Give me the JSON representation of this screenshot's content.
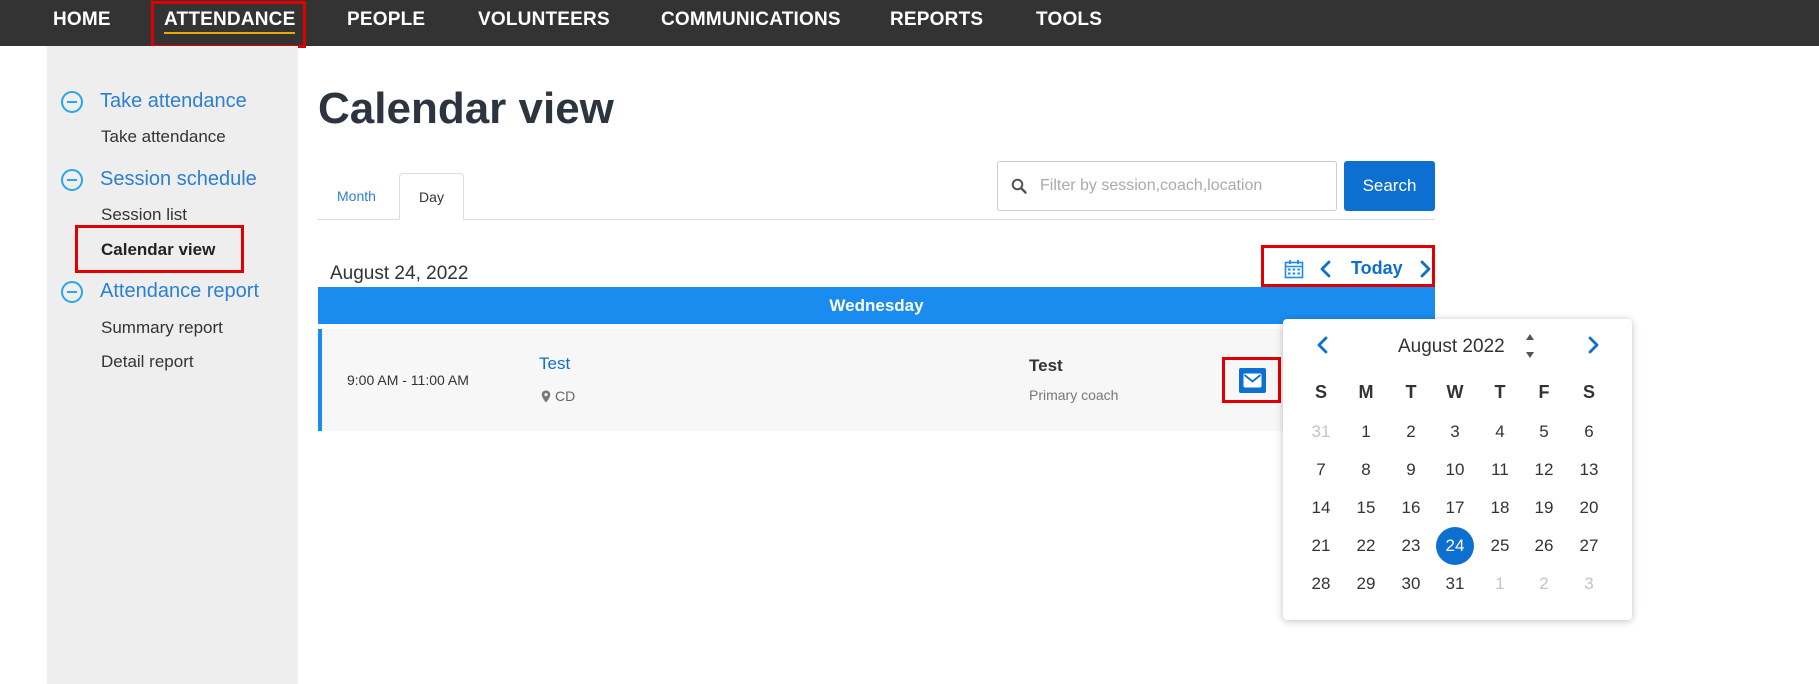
{
  "nav": {
    "items": [
      {
        "label": "HOME"
      },
      {
        "label": "ATTENDANCE"
      },
      {
        "label": "PEOPLE"
      },
      {
        "label": "VOLUNTEERS"
      },
      {
        "label": "COMMUNICATIONS"
      },
      {
        "label": "REPORTS"
      },
      {
        "label": "TOOLS"
      }
    ],
    "active": "ATTENDANCE"
  },
  "sidebar": {
    "groups": [
      {
        "label": "Take attendance",
        "links": [
          "Take attendance"
        ]
      },
      {
        "label": "Session schedule",
        "links": [
          "Session list",
          "Calendar view"
        ]
      },
      {
        "label": "Attendance report",
        "links": [
          "Summary report",
          "Detail report"
        ]
      }
    ],
    "current": "Calendar view"
  },
  "page": {
    "title": "Calendar view"
  },
  "tabs": {
    "month": "Month",
    "day": "Day",
    "active": "Day"
  },
  "search": {
    "placeholder": "Filter by session,coach,location",
    "value": "",
    "button": "Search"
  },
  "day_view": {
    "date": "August 24, 2022",
    "today_label": "Today",
    "weekday": "Wednesday",
    "sessions": [
      {
        "time": "9:00 AM - 11:00 AM",
        "name": "Test",
        "location": "CD",
        "coach": "Test",
        "coach_role": "Primary coach"
      }
    ]
  },
  "datepicker": {
    "title": "August 2022",
    "weekdays": [
      "S",
      "M",
      "T",
      "W",
      "T",
      "F",
      "S"
    ],
    "weeks": [
      [
        "31",
        "1",
        "2",
        "3",
        "4",
        "5",
        "6"
      ],
      [
        "7",
        "8",
        "9",
        "10",
        "11",
        "12",
        "13"
      ],
      [
        "14",
        "15",
        "16",
        "17",
        "18",
        "19",
        "20"
      ],
      [
        "21",
        "22",
        "23",
        "24",
        "25",
        "26",
        "27"
      ],
      [
        "28",
        "29",
        "30",
        "31",
        "1",
        "2",
        "3"
      ]
    ],
    "selected": "24"
  },
  "colors": {
    "accent": "#0d6fd0",
    "day_header": "#1a8cf0",
    "nav_bg": "#333333",
    "highlight_box": "#e00000"
  }
}
